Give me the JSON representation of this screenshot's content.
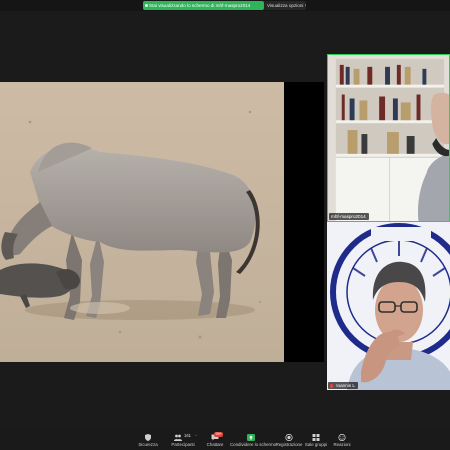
{
  "topbar": {
    "share_status": "Stai visualizzando lo schermo di mhf-maspro2014",
    "view_options": "Visualizza opzioni"
  },
  "shared_screen": {
    "content": "photo",
    "icon": "zebu-photo"
  },
  "participants": [
    {
      "name": "mhf-maspro2014",
      "active_speaker": true
    },
    {
      "name": "Ioannis L",
      "muted": true
    }
  ],
  "toolbar": {
    "items": [
      {
        "id": "security",
        "label": "Sicurezza",
        "icon": "shield-icon"
      },
      {
        "id": "participants",
        "label": "Partecipanti",
        "icon": "people-icon",
        "count": "161"
      },
      {
        "id": "chat",
        "label": "Chattare",
        "icon": "chat-icon",
        "badge": "99+"
      },
      {
        "id": "share",
        "label": "Condividere lo schermo",
        "icon": "share-screen-icon"
      },
      {
        "id": "record",
        "label": "Registrazione",
        "icon": "record-icon"
      },
      {
        "id": "breakout",
        "label": "Sale gruppi",
        "icon": "breakout-icon"
      },
      {
        "id": "reactions",
        "label": "Reazioni",
        "icon": "reaction-icon"
      }
    ]
  },
  "colors": {
    "share_green": "#2fb45a",
    "speaker_border": "#2fcf51",
    "badge_red": "#e0423c",
    "toolbar_bg": "#1a1a1a"
  }
}
